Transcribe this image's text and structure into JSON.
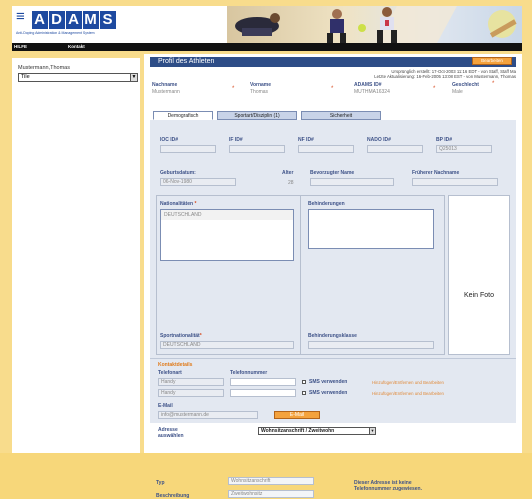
{
  "header": {
    "logo_arrow": "≡",
    "logo_letters": [
      "A",
      "D",
      "A",
      "M",
      "S"
    ],
    "tagline": "Anti-Doping Administration & Management System"
  },
  "menubar": {
    "help": "HILFE",
    "contact": "Kontakt"
  },
  "left": {
    "user": "Mustermann,Thomas",
    "role": "Tile"
  },
  "profile": {
    "title": "Profil des Athleten",
    "top_button": "Bearbeiten",
    "created_line": "Ursprünglich erstellt: 17-Oct-2003 11:16 EDT - von Staff, Staff Ma",
    "changed_line": "Letzte Aktualisierung: 16-Feb-2005 13:08 EST - von Mustermann, Thomas",
    "fields": {
      "lastname_label": "Nachname",
      "lastname": "Mustermann",
      "firstname_label": "Vorname",
      "firstname": "Thomas",
      "adams_label": "ADAMS ID#",
      "adams": "MUTHMA16324",
      "gender_label": "Geschlecht",
      "gender": "Male"
    },
    "tabs": [
      "Demografisch",
      "Sportart/Disziplin (1)",
      "Sicherheit"
    ],
    "ids": [
      {
        "label": "IOC ID#",
        "value": ""
      },
      {
        "label": "IF ID#",
        "value": ""
      },
      {
        "label": "NF ID#",
        "value": ""
      },
      {
        "label": "NADO ID#",
        "value": ""
      },
      {
        "label": "BP ID#",
        "value": "Q25013"
      }
    ],
    "birth_label": "Geburtsdatum:",
    "birth": "06-Nov-1980",
    "age_label": "Alter",
    "age": "28",
    "preferred_label": "Bevorzugter Name",
    "former_label": "Früherer Nachname",
    "nationality_label": "Nationalitäten",
    "nationality": "DEUTSCHLAND",
    "handicap_label": "Behinderungen",
    "photo_text": "Kein Foto",
    "sport_nat_label": "Sportnationalität",
    "sport_nat": "DEUTSCHLAND",
    "handicap_class_label": "Behinderungsklasse",
    "contact_header": "Kontaktdetails",
    "phone_type_label": "Telefonart",
    "phone_number_label": "Telefonnummer",
    "phones": [
      {
        "type": "Handy",
        "sms": "SMS verwenden",
        "link": "Hinzufügen/Entfernen und Bearbeiten"
      },
      {
        "type": "Handy",
        "sms": "SMS verwenden",
        "link": "Hinzufügen/Entfernen und Bearbeiten"
      }
    ],
    "email_label": "E-Mail",
    "email": "info@mustermann.de",
    "email_button": "E-Mail",
    "address_label_1": "Adresse",
    "address_label_2": "auswählen",
    "address_select": "Wohnsitzanschrift / Zweitwohn",
    "type_label": "Typ",
    "type": "Wohnsitzanschrift",
    "desc_label": "Beschreibung",
    "desc": "Zweitwohnsitz",
    "no_phone_note_1": "Dieser Adresse ist keine",
    "no_phone_note_2": "Telefonnummer zugewiesen."
  },
  "colors": {
    "title_bar": "#2e4d87",
    "accent": "#f4a23d",
    "label": "#3e5288",
    "background": "#f8dc8c"
  }
}
